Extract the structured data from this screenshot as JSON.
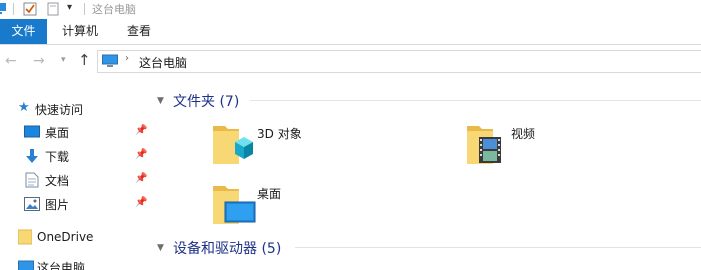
{
  "window": {
    "title": "这台电脑"
  },
  "ribbon": {
    "tabs": [
      "文件",
      "计算机",
      "查看"
    ]
  },
  "address": {
    "location": "这台电脑"
  },
  "sidebar": {
    "quick_access": "快速访问",
    "items": [
      {
        "label": "桌面",
        "icon": "desktop-icon",
        "pinned": true
      },
      {
        "label": "下载",
        "icon": "download-icon",
        "pinned": true
      },
      {
        "label": "文档",
        "icon": "document-icon",
        "pinned": true
      },
      {
        "label": "图片",
        "icon": "pictures-icon",
        "pinned": true
      }
    ],
    "onedrive": "OneDrive",
    "this_pc": "这台电脑"
  },
  "content": {
    "folders_group": "文件夹 (7)",
    "folders": [
      {
        "label": "3D 对象",
        "icon": "3d-objects-folder-icon"
      },
      {
        "label": "视频",
        "icon": "videos-folder-icon"
      },
      {
        "label": "桌面",
        "icon": "desktop-folder-icon"
      }
    ],
    "devices_group": "设备和驱动器 (5)"
  },
  "colors": {
    "accent": "#1979ca",
    "group_title": "#1e3287",
    "folder": "#f8d775"
  }
}
